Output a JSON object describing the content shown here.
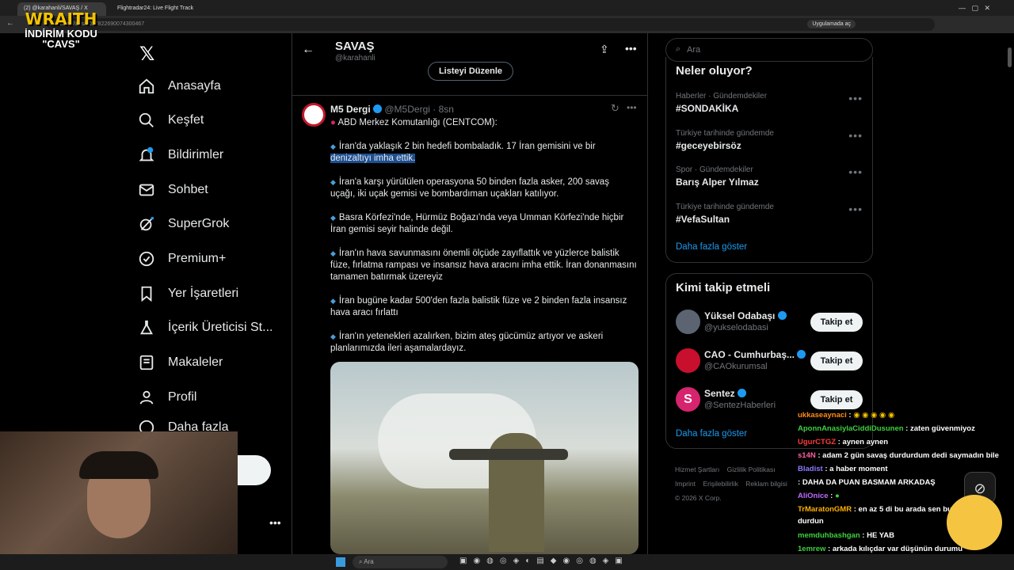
{
  "browser": {
    "tabs": [
      {
        "title": "(2) @karahanli/SAVAŞ / X"
      },
      {
        "title": "Flightradar24: Live Flight Track"
      }
    ],
    "url": "x.com/i/lists/2027822690074300467",
    "right_badge": "Uygulamada aç"
  },
  "overlay": {
    "brand": "WRAITH",
    "promo_line1": "İNDİRİM KODU",
    "promo_line2": "\"CAVS\""
  },
  "nav": {
    "items": [
      {
        "label": "Anasayfa",
        "icon": "home-icon"
      },
      {
        "label": "Keşfet",
        "icon": "search-icon"
      },
      {
        "label": "Bildirimler",
        "icon": "bell-icon",
        "badge": "2"
      },
      {
        "label": "Sohbet",
        "icon": "mail-icon"
      },
      {
        "label": "SuperGrok",
        "icon": "grok-icon"
      },
      {
        "label": "Premium+",
        "icon": "verified-icon"
      },
      {
        "label": "Yer İşaretleri",
        "icon": "bookmark-icon"
      },
      {
        "label": "İçerik Üreticisi St...",
        "icon": "flask-icon"
      },
      {
        "label": "Makaleler",
        "icon": "article-icon"
      },
      {
        "label": "Profil",
        "icon": "person-icon"
      },
      {
        "label": "Daha fazla",
        "icon": "more-circle-icon"
      }
    ]
  },
  "header": {
    "title": "SAVAŞ",
    "handle": "@karahanli",
    "edit_list_label": "Listeyi Düzenle"
  },
  "tweet": {
    "author": "M5 Dergi",
    "handle": "@M5Dergi",
    "time": "8sn",
    "first_line": "ABD Merkez Komutanlığı (CENTCOM):",
    "paragraphs": [
      [
        "İran'da yaklaşık 2 bin hedefi bombaladık. 17 İran gemisini ve bir",
        "denizaltıyı imha ettik."
      ],
      [
        "İran'a karşı yürütülen operasyona 50 binden fazla asker, 200 savaş",
        "uçağı, iki uçak gemisi ve bombardıman uçakları katılıyor."
      ],
      [
        "Basra Körfezi'nde, Hürmüz Boğazı'nda veya Umman Körfezi'nde hiçbir",
        "İran gemisi seyir halinde değil."
      ],
      [
        "İran'ın hava savunmasını önemli ölçüde zayıflattık ve yüzlerce balistik",
        "füze, fırlatma rampası ve insansız hava aracını imha ettik. İran donanmasını",
        "tamamen batırmak üzereyiz"
      ],
      [
        "İran bugüne kadar 500'den fazla balistik füze ve 2 binden fazla insansız",
        "hava aracı fırlattı"
      ],
      [
        "İran'ın yetenekleri azalırken, bizim ateş gücümüz artıyor ve askeri",
        "planlarımızda ileri aşamalardayız."
      ]
    ]
  },
  "search": {
    "placeholder": "Ara"
  },
  "trends": {
    "title": "Neler oluyor?",
    "items": [
      {
        "meta": "Haberler · Gündemdekiler",
        "title": "#SONDAKİKA"
      },
      {
        "meta": "Türkiye tarihinde gündemde",
        "title": "#geceyebirsöz"
      },
      {
        "meta": "Spor · Gündemdekiler",
        "title": "Barış Alper Yılmaz"
      },
      {
        "meta": "Türkiye tarihinde gündemde",
        "title": "#VefaSultan"
      }
    ],
    "show_more": "Daha fazla göster"
  },
  "who_to_follow": {
    "title": "Kimi takip etmeli",
    "items": [
      {
        "name": "Yüksel Odabaşı",
        "handle": "@yukselodabasi",
        "button": "Takip et",
        "avatar_color": "#5b6470"
      },
      {
        "name": "CAO - Cumhurbaş...",
        "handle": "@CAOkurumsal",
        "button": "Takip et",
        "avatar_color": "#c8102e"
      },
      {
        "name": "Sentez",
        "handle": "@SentezHaberleri",
        "button": "Takip et",
        "avatar_color": "#d6246e",
        "avatar_letter": "S"
      }
    ],
    "show_more": "Daha fazla göster"
  },
  "footer": {
    "links": [
      "Hizmet Şartları",
      "Gizlilik Politikası",
      "Imprint",
      "Erişilebilirlik",
      "Reklam bilgisi"
    ],
    "copyright": "© 2026 X Corp."
  },
  "chat": [
    {
      "user": "ukkaseaynaci",
      "msg": "",
      "color": "#ff8c1a"
    },
    {
      "user": "AponnAnasiylaCiddiDusunen",
      "msg": "zaten güvenmiyoz",
      "color": "#3fd13f"
    },
    {
      "user": "UgurCTGZ",
      "msg": "aynen aynen",
      "color": "#ff3b3b"
    },
    {
      "user": "s14N",
      "msg": "adam 2 gün savaş durdurdum dedi saymadın bile",
      "color": "#ff5fa2"
    },
    {
      "user": "Bladist",
      "msg": "a haber moment",
      "color": "#8a7bff"
    },
    {
      "user": "",
      "msg": "DAHA DA PUAN BASMAM ARKADAŞ",
      "color": "#ff3b3b"
    },
    {
      "user": "AliOnice",
      "msg": "",
      "color": "#c06bff"
    },
    {
      "user": "TrMaratonGMR",
      "msg": "en az 5 di bu arada sen burda",
      "color": "#ffb000"
    },
    {
      "user": "",
      "msg": "durdun",
      "color": "#ffffff"
    },
    {
      "user": "memduhbashgan",
      "msg": "HE YAB",
      "color": "#3fd13f"
    },
    {
      "user": "1emrew",
      "msg": "arkada kılıçdar var düşünün durumu",
      "color": "#3fd13f"
    }
  ],
  "taskbar": {
    "search_placeholder": "Ara"
  },
  "colors": {
    "accent": "#1d9bf0",
    "highlight": "#1d4f91",
    "border": "#2f3336"
  }
}
